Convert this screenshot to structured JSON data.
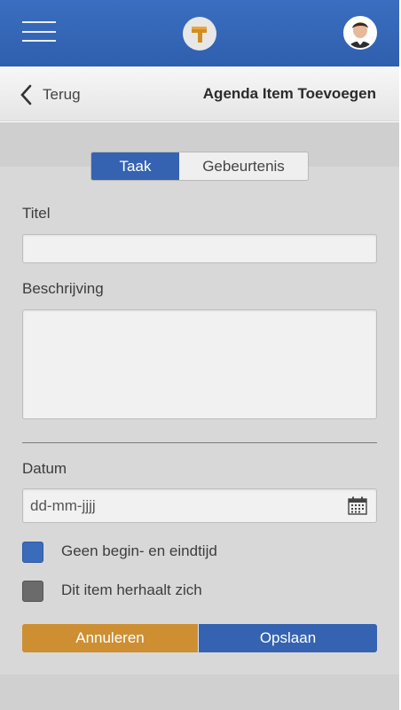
{
  "header": {
    "menu_icon": "hamburger-menu-icon",
    "logo_icon": "app-logo-icon",
    "avatar_icon": "user-avatar-icon",
    "colors": {
      "primary": "#3563b1",
      "accent": "#cd8f32"
    }
  },
  "subheader": {
    "back_label": "Terug",
    "title": "Agenda Item Toevoegen"
  },
  "segments": {
    "active": "Taak",
    "inactive": "Gebeurtenis"
  },
  "form": {
    "title_label": "Titel",
    "title_value": "",
    "description_label": "Beschrijving",
    "description_value": "",
    "date_label": "Datum",
    "date_placeholder": "dd-mm-jjjj",
    "no_time_label": "Geen begin- en eindtijd",
    "repeat_label": "Dit item herhaalt zich"
  },
  "actions": {
    "cancel": "Annuleren",
    "save": "Opslaan"
  }
}
